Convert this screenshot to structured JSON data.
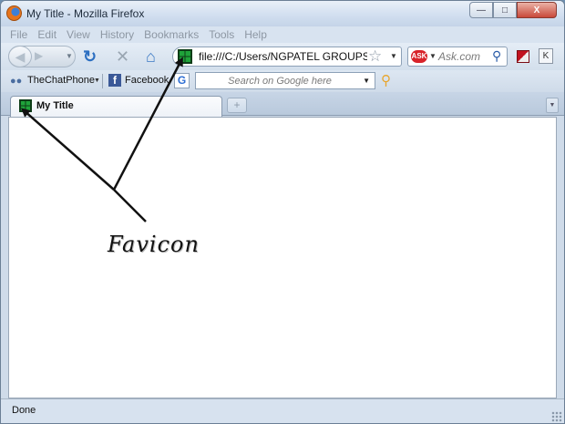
{
  "window": {
    "title": "My Title - Mozilla Firefox",
    "controls": {
      "minimize": "—",
      "maximize": "□",
      "close": "X"
    }
  },
  "menu": {
    "items": [
      {
        "label": "File"
      },
      {
        "label": "Edit"
      },
      {
        "label": "View"
      },
      {
        "label": "History"
      },
      {
        "label": "Bookmarks"
      },
      {
        "label": "Tools"
      },
      {
        "label": "Help"
      }
    ]
  },
  "nav": {
    "back_icon": "back-arrow-icon",
    "forward_icon": "forward-arrow-icon",
    "reload_icon": "reload-icon",
    "stop_icon": "stop-icon",
    "home_icon": "home-icon",
    "url": "file:///C:/Users/NGPATEL GROUPS/D",
    "search_engine": "Ask",
    "search_placeholder": "Ask.com"
  },
  "bookmarks": {
    "items": [
      {
        "label": "TheChatPhone",
        "icon": "people-icon"
      },
      {
        "label": "Facebook",
        "icon": "facebook-icon"
      }
    ],
    "google_placeholder": "Search on Google here"
  },
  "tabs": [
    {
      "label": "My Title",
      "active": true,
      "favicon": "green-grid-icon"
    }
  ],
  "annotation": {
    "label": "Favicon"
  },
  "status": {
    "text": "Done"
  },
  "colors": {
    "chrome": "#cfdbe9",
    "favicon_green": "#1fa33a",
    "facebook_blue": "#3b5998",
    "ask_red": "#d8232a"
  }
}
